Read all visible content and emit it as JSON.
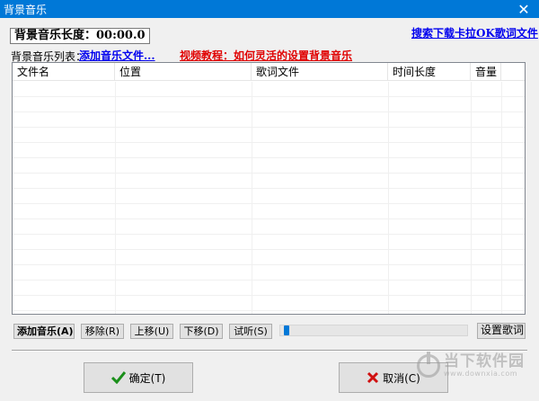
{
  "window": {
    "title": "背景音乐",
    "close_glyph": "✕",
    "titlebar_color": "#0078d7"
  },
  "music_length": "背景音乐长度：00:00.0",
  "links": {
    "search_lyrics": "搜索下载卡拉OK歌词文件",
    "add_music_file": "添加音乐文件...",
    "video_tutorial": "视频教程：如何灵活的设置背景音乐"
  },
  "list": {
    "label": "背景音乐列表：",
    "columns": [
      "文件名",
      "位置",
      "歌词文件",
      "时间长度",
      "音量"
    ]
  },
  "buttons": {
    "add_music": "添加音乐(A)",
    "remove": "移除(R)",
    "move_up": "上移(U)",
    "move_down": "下移(D)",
    "preview": "试听(S)",
    "set_lyrics": "设置歌词",
    "ok": "确定(T)",
    "cancel": "取消(C)"
  },
  "preview_volume": {
    "level": 0.02
  },
  "icons": {
    "ok": "check-icon",
    "cancel": "x-icon",
    "ok_color": "#1a8f1a",
    "cancel_color": "#d01010"
  },
  "watermark": {
    "cn": "当下软件园",
    "en": "www.downxia.com"
  }
}
